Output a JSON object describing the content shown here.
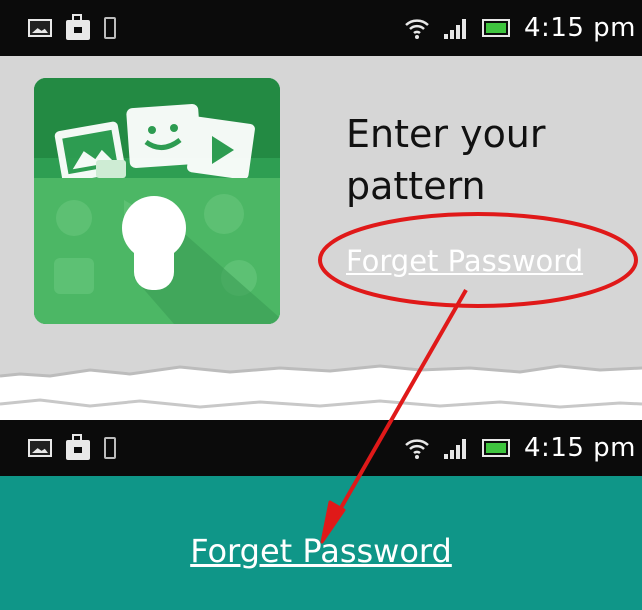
{
  "status_bar": {
    "time": "4:15 pm",
    "left_icons": [
      "photo-icon",
      "briefcase-icon",
      "phone-icon"
    ],
    "right_icons": [
      "wifi-icon",
      "signal-bars-icon",
      "battery-icon"
    ]
  },
  "lock_screen": {
    "prompt": "Enter your pattern",
    "forget_link": "Forget Password",
    "app_icon": "vault-lock-icon"
  },
  "reset_screen": {
    "forget_link": "Forget Password"
  },
  "colors": {
    "status_bar": "#0b0b0b",
    "lock_panel": "#d6d6d6",
    "teal_panel": "#0f9688",
    "icon_green": "#2e9e52",
    "annotation_red": "#e01919"
  }
}
